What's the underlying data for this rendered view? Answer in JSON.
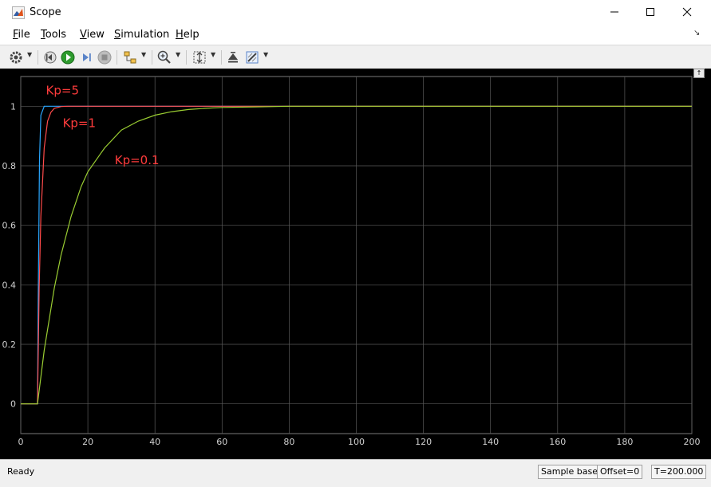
{
  "window": {
    "title": "Scope"
  },
  "menu": [
    {
      "underline": "F",
      "rest": "ile"
    },
    {
      "underline": "T",
      "rest": "ools"
    },
    {
      "underline": "V",
      "rest": "iew"
    },
    {
      "underline": "S",
      "rest": "imulation"
    },
    {
      "underline": "H",
      "rest": "elp"
    }
  ],
  "toolbar": {
    "icons": [
      "settings-icon",
      "step-back-icon",
      "run-icon",
      "step-forward-icon",
      "stop-icon",
      "signal-selector-icon",
      "zoom-in-icon",
      "autoscale-icon",
      "restore-icon",
      "highlight-icon"
    ]
  },
  "status": {
    "ready": "Ready",
    "sample_based": "Sample based",
    "offset": "Offset=0",
    "time": "T=200.000"
  },
  "colors": {
    "plot_bg": "#000000",
    "grid": "#5a5a5a",
    "axis_text": "#d0d0d0",
    "annotation": "#ff3c3c"
  },
  "chart_data": {
    "type": "line",
    "title": "",
    "xlabel": "",
    "ylabel": "",
    "xlim": [
      0,
      200
    ],
    "ylim": [
      -0.1,
      1.1
    ],
    "xticks": [
      0,
      20,
      40,
      60,
      80,
      100,
      120,
      140,
      160,
      180,
      200
    ],
    "yticks": [
      0,
      0.2,
      0.4,
      0.6,
      0.8,
      1
    ],
    "ytick_labels": [
      "0",
      "0.2",
      "0.4",
      "0.6",
      "0.8",
      "1"
    ],
    "grid": true,
    "series": [
      {
        "color": "#2aa7ff",
        "x": [
          0,
          5,
          5.2,
          5.6,
          6.0,
          7,
          10,
          200
        ],
        "y": [
          0,
          0,
          0.35,
          0.82,
          0.97,
          1.0,
          1.0,
          1.0
        ]
      },
      {
        "color": "#ff4b4b",
        "x": [
          0,
          5,
          5.5,
          6,
          7,
          8,
          9,
          10,
          12,
          14,
          200
        ],
        "y": [
          0,
          0,
          0.39,
          0.63,
          0.86,
          0.95,
          0.98,
          0.993,
          0.999,
          1.0,
          1.0
        ]
      },
      {
        "color": "#9acd32",
        "x": [
          0,
          5,
          7,
          10,
          12,
          15,
          18,
          20,
          25,
          30,
          35,
          40,
          45,
          50,
          55,
          60,
          70,
          80,
          100,
          200
        ],
        "y": [
          0,
          0,
          0.18,
          0.39,
          0.5,
          0.63,
          0.73,
          0.78,
          0.86,
          0.92,
          0.95,
          0.97,
          0.982,
          0.989,
          0.993,
          0.996,
          0.998,
          1.0,
          1.0,
          1.0
        ]
      }
    ],
    "annotations": [
      {
        "text": "Kp=5",
        "x": 7.5,
        "y": 1.04
      },
      {
        "text": "Kp=1",
        "x": 12.5,
        "y": 0.93
      },
      {
        "text": "Kp=0.1",
        "x": 28,
        "y": 0.805
      }
    ]
  }
}
